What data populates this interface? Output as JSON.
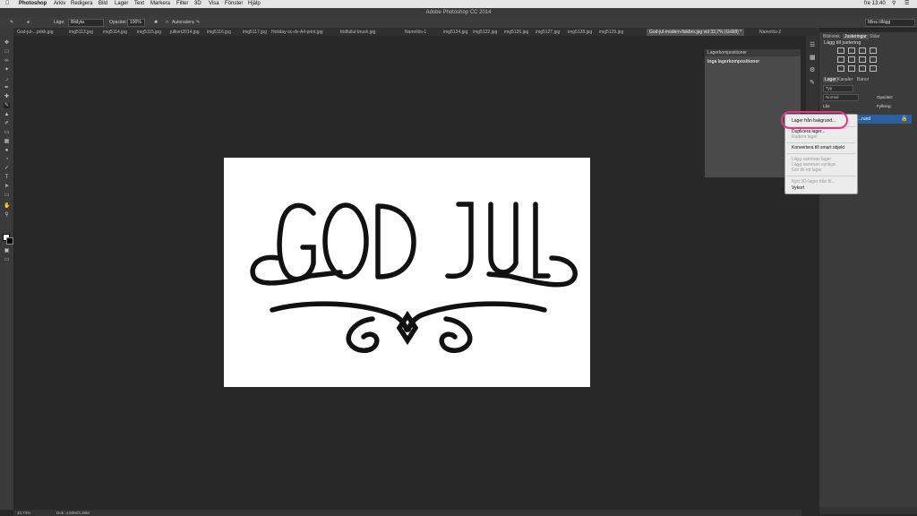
{
  "menubar": {
    "items": [
      "Photoshop",
      "Arkiv",
      "Redigera",
      "Bild",
      "Lager",
      "Text",
      "Markera",
      "Filter",
      "3D",
      "Visa",
      "Fönster",
      "Hjälp"
    ],
    "clock": "fre 13:40"
  },
  "window": {
    "title": "Adobe Photoshop CC 2014"
  },
  "options": {
    "mode_label": "Läge:",
    "mode_value": "Bildyta",
    "opacity_label": "Opacitet:",
    "opacity_value": "100%",
    "autoerase_label": "Autoradera",
    "workspace": "Mina tillägg"
  },
  "tabs": [
    "God-jul-...prikk.jpg",
    "img5113.jpg",
    "img5114.jpg",
    "img5115.jpg",
    "julkort2014.jpg",
    "img5116.jpg",
    "img5117.jpg",
    "Holiday-sc-dv-A4-print.jpg",
    "fridfullul-brush.jpg",
    "Namnlös-1",
    "img5124.jpg",
    "img5122.jpg",
    "img5126.jpg",
    "img5127.jpg",
    "img5128.jpg",
    "img5129.jpg",
    "God-jul-modern-fiskbrn.jpg vid 33,7% (Grå/8) *",
    "Namnlös-2"
  ],
  "layer_comps": {
    "header": "Lagerkompositioner",
    "subtitle": "Inga lagerkompositioner"
  },
  "right_panel": {
    "tabs_top": [
      "Bibliotek",
      "Justeringar",
      "Stilar"
    ],
    "adjust_heading": "Lägg till justering",
    "tabs_layers": [
      "Lager",
      "Kanaler",
      "Banor"
    ],
    "kind_label": "Typ",
    "blend_value": "Normal",
    "opacity_label": "Opacitet:",
    "fill_label": "Fyllning:",
    "lock_label": "Lås:",
    "layer_name": "...rund"
  },
  "context_menu": {
    "items": [
      {
        "label": "Lager från bakgrund...",
        "enabled": true
      },
      {
        "label": "Duplicera lager...",
        "enabled": true
      },
      {
        "label": "Radera lager",
        "enabled": false
      },
      {
        "label": "Konvertera till smart objekt",
        "enabled": true
      },
      {
        "label": "Lägg samman lager",
        "enabled": false
      },
      {
        "label": "Lägg samman synliga",
        "enabled": false
      },
      {
        "label": "Gör till ett lager",
        "enabled": false
      },
      {
        "label": "Nytt 3D-lager från fil...",
        "enabled": false
      },
      {
        "label": "Vykort",
        "enabled": true
      }
    ]
  },
  "canvas_text": {
    "line1": "GOD JUL"
  },
  "status": {
    "zoom": "33,74%",
    "doc": "Dok: 4,50M/3,38M"
  },
  "colors": {
    "highlight": "#e9338a",
    "selection": "#2b5f9e"
  }
}
